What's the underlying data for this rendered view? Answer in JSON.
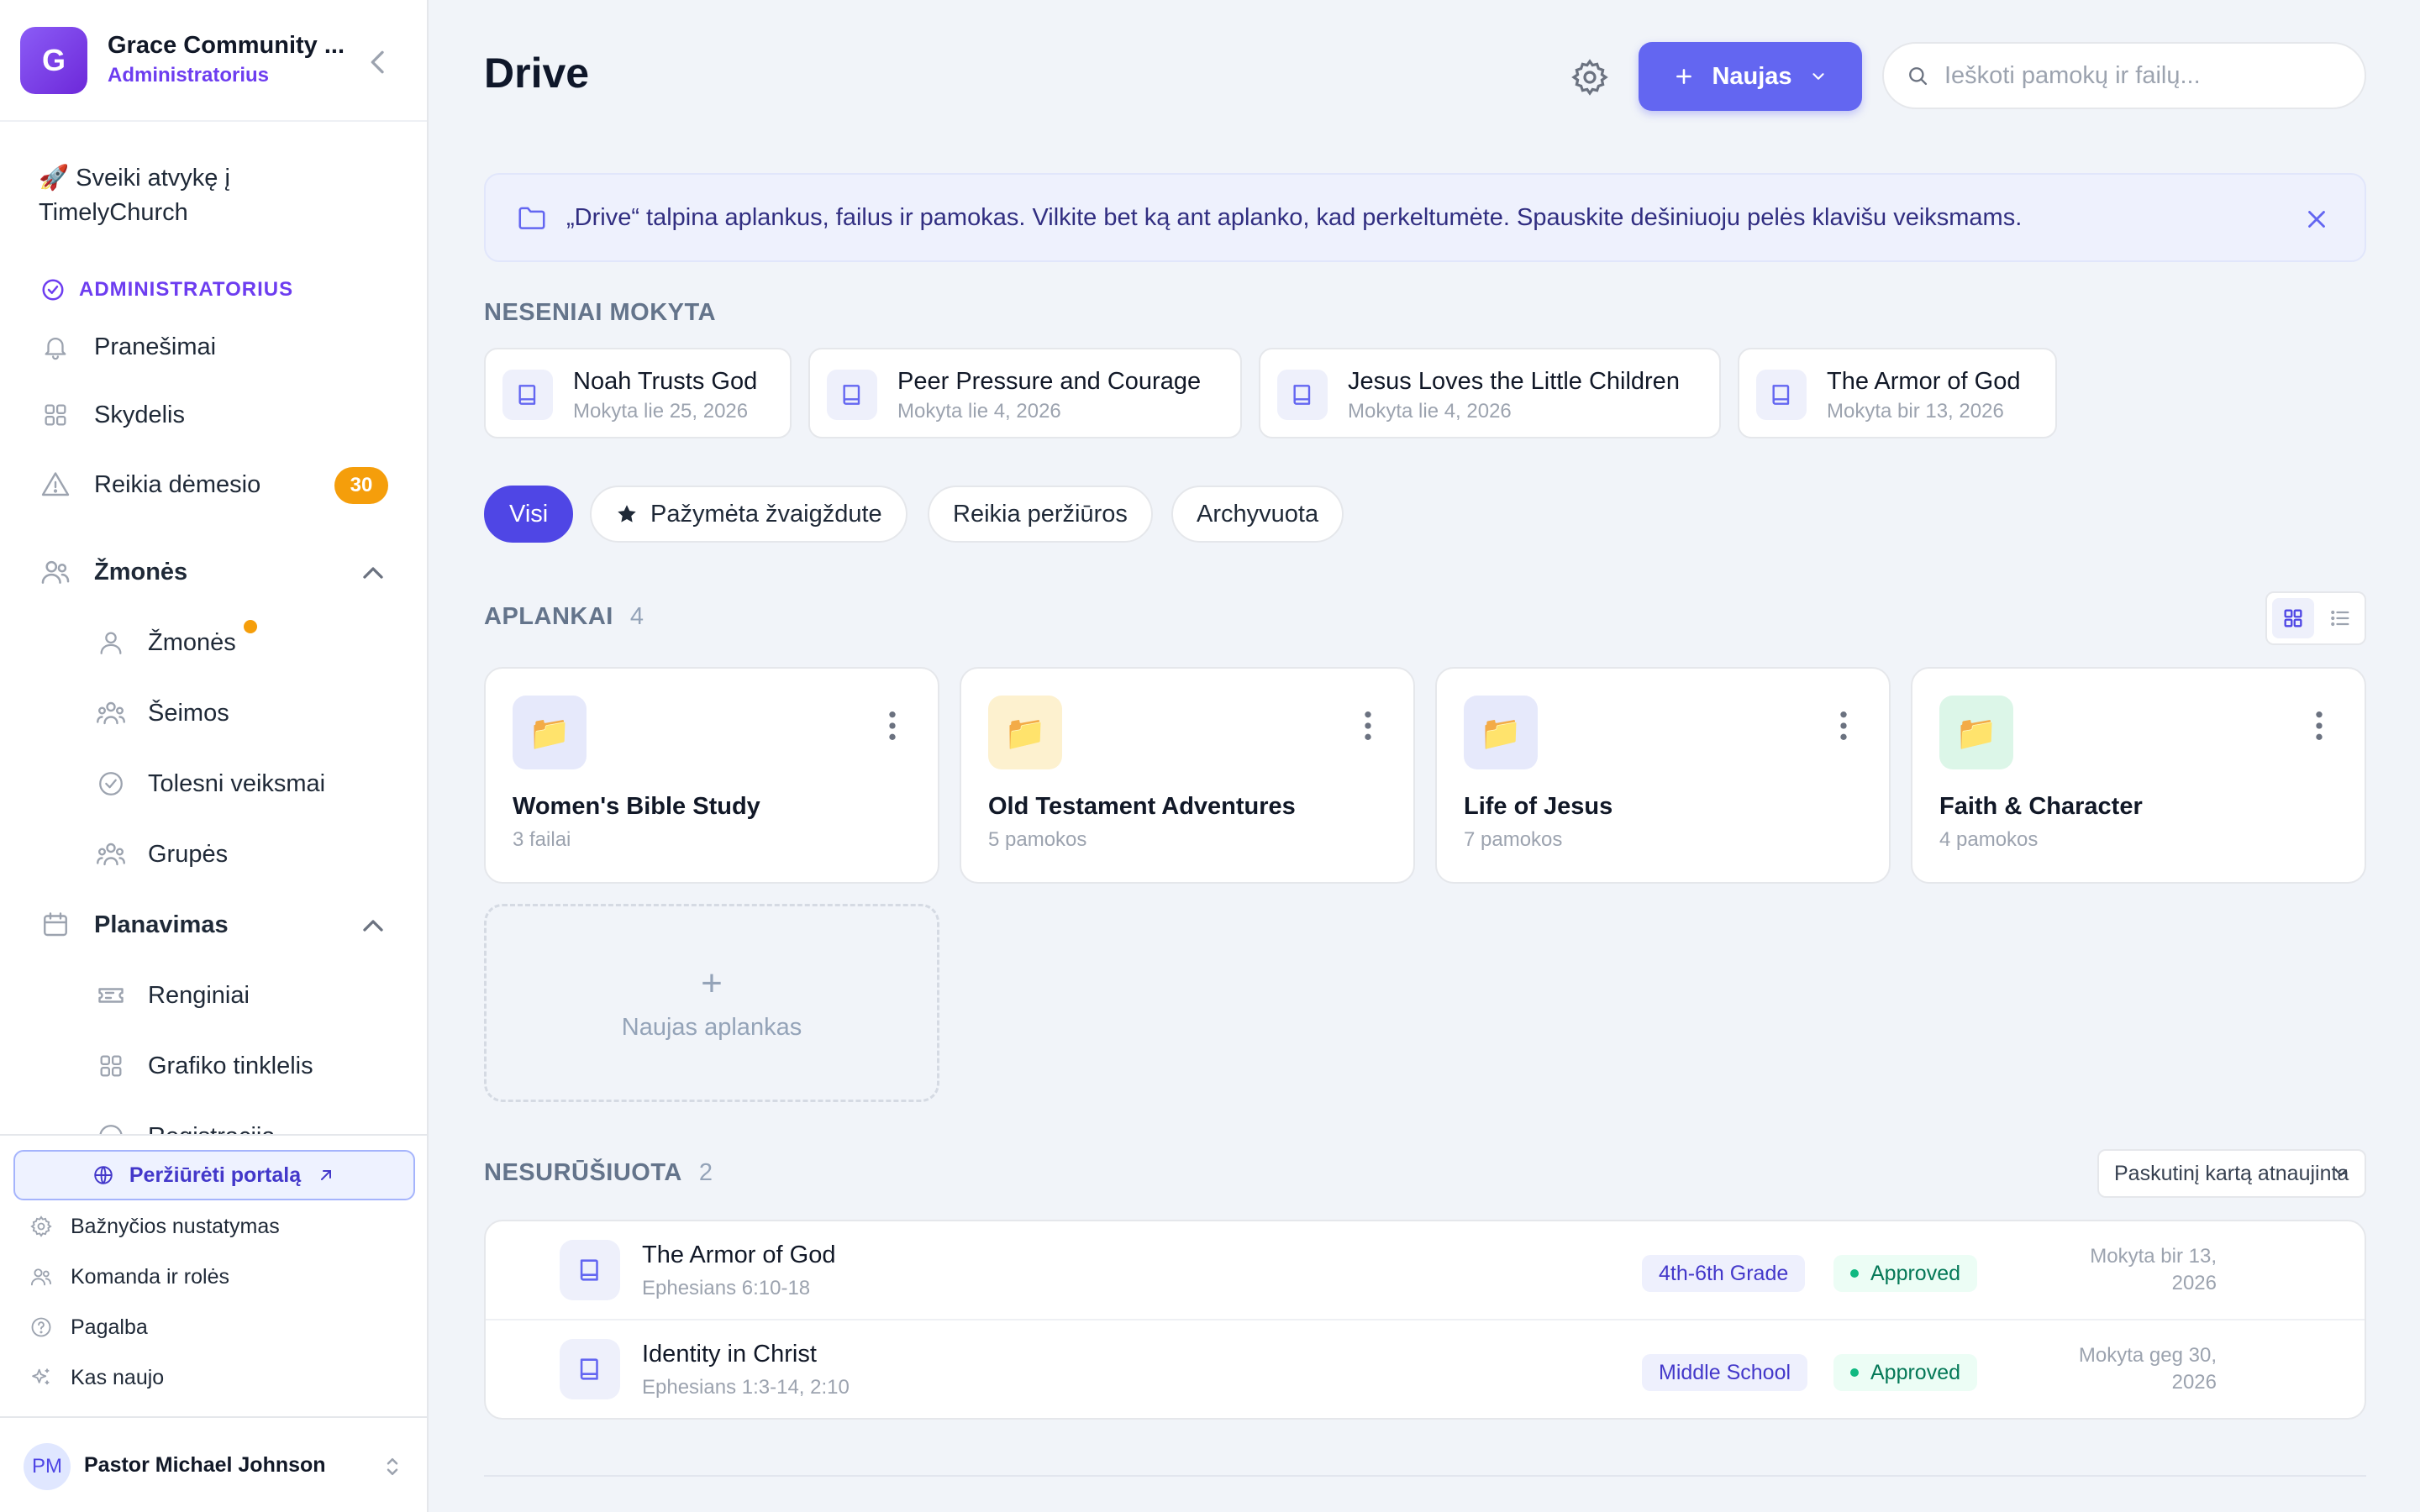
{
  "workspace": {
    "initial": "G",
    "name": "Grace Community ...",
    "role": "Administratorius"
  },
  "sidebar": {
    "welcome": "🚀 Sveiki atvykę į TimelyChurch",
    "section_label": "ADMINISTRATORIUS",
    "items": [
      {
        "label": "Pranešimai",
        "icon": "bell-icon"
      },
      {
        "label": "Skydelis",
        "icon": "grid-icon"
      },
      {
        "label": "Reikia dėmesio",
        "icon": "warning-icon",
        "badge": "30"
      }
    ],
    "people_group": {
      "label": "Žmonės",
      "icon": "users-icon",
      "children": [
        {
          "label": "Žmonės",
          "icon": "user-icon"
        },
        {
          "label": "Šeimos",
          "icon": "family-icon"
        },
        {
          "label": "Tolesni veiksmai",
          "icon": "check-circle-icon"
        },
        {
          "label": "Grupės",
          "icon": "group-icon"
        }
      ]
    },
    "planning_group": {
      "label": "Planavimas",
      "icon": "calendar-icon",
      "children": [
        {
          "label": "Renginiai",
          "icon": "ticket-icon"
        },
        {
          "label": "Grafiko tinklelis",
          "icon": "grid-icon"
        },
        {
          "label": "Registracija",
          "icon": "check-circle-icon"
        }
      ]
    },
    "portal_button": "Peržiūrėti portalą",
    "footer_links": [
      {
        "label": "Bažnyčios nustatymas",
        "icon": "gear-icon"
      },
      {
        "label": "Komanda ir rolės",
        "icon": "users-icon"
      },
      {
        "label": "Pagalba",
        "icon": "help-icon"
      },
      {
        "label": "Kas naujo",
        "icon": "sparkle-icon"
      }
    ],
    "user": {
      "initials": "PM",
      "name": "Pastor Michael Johnson"
    }
  },
  "header": {
    "title": "Drive",
    "new_button": "Naujas",
    "search_placeholder": "Ieškoti pamokų ir failų..."
  },
  "banner": {
    "text": "„Drive“ talpina aplankus, failus ir pamokas. Vilkite bet ką ant aplanko, kad perkeltumėte. Spauskite dešiniuoju pelės klavišu veiksmams."
  },
  "recent": {
    "title": "NESENIAI MOKYTA",
    "items": [
      {
        "title": "Noah Trusts God",
        "sub": "Mokyta lie 25, 2026"
      },
      {
        "title": "Peer Pressure and Courage",
        "sub": "Mokyta lie 4, 2026"
      },
      {
        "title": "Jesus Loves the Little Children",
        "sub": "Mokyta lie 4, 2026"
      },
      {
        "title": "The Armor of God",
        "sub": "Mokyta bir 13, 2026"
      }
    ]
  },
  "filters": [
    {
      "label": "Visi",
      "active": true
    },
    {
      "label": "Pažymėta žvaigždute",
      "active": false,
      "icon": "star-icon"
    },
    {
      "label": "Reikia peržiūros",
      "active": false
    },
    {
      "label": "Archyvuota",
      "active": false
    }
  ],
  "folders": {
    "title": "APLANKAI",
    "count": "4",
    "items": [
      {
        "name": "Women's Bible Study",
        "sub": "3 failai",
        "color": "#e6e9fb"
      },
      {
        "name": "Old Testament Adventures",
        "sub": "5 pamokos",
        "color": "#fdf1cf"
      },
      {
        "name": "Life of Jesus",
        "sub": "7 pamokos",
        "color": "#e6e9fb"
      },
      {
        "name": "Faith & Character",
        "sub": "4 pamokos",
        "color": "#dcf6e8"
      }
    ],
    "new_folder": "Naujas aplankas"
  },
  "unsorted": {
    "title": "NESURŪŠIUOTA",
    "count": "2",
    "sort_label": "Paskutinį kartą atnaujinta",
    "rows": [
      {
        "title": "The Armor of God",
        "ref": "Ephesians 6:10-18",
        "grade": "4th-6th Grade",
        "status": "Approved",
        "taught_line1": "Mokyta bir 13,",
        "taught_line2": "2026"
      },
      {
        "title": "Identity in Christ",
        "ref": "Ephesians 1:3-14, 2:10",
        "grade": "Middle School",
        "status": "Approved",
        "taught_line1": "Mokyta geg 30,",
        "taught_line2": "2026"
      }
    ]
  },
  "colors": {
    "accent": "#6366f1",
    "accent_dark": "#4f46e5",
    "brand_purple": "#6d3df0",
    "warning": "#f59e0b",
    "success": "#10b981"
  }
}
